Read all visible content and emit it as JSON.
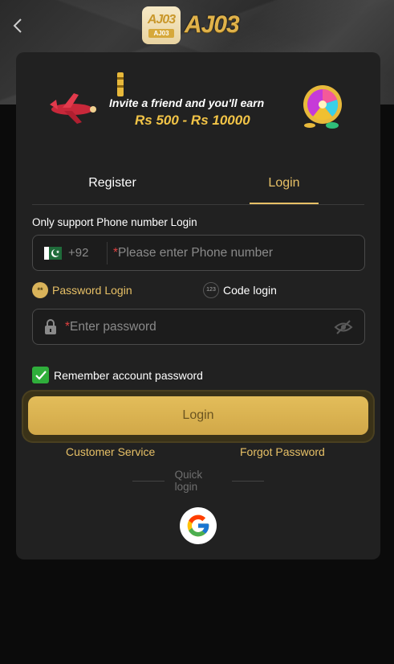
{
  "header": {
    "logo_badge_big": "AJ03",
    "logo_badge_small": "AJ03",
    "logo_text": "AJ03"
  },
  "banner": {
    "line1": "Invite a friend and you'll earn",
    "line2": "Rs 500 - Rs 10000"
  },
  "tabs": [
    {
      "label": "Register",
      "active": false
    },
    {
      "label": "Login",
      "active": true
    }
  ],
  "form": {
    "support_label": "Only support Phone number Login",
    "country_code": "+92",
    "phone_required_mark": "*",
    "phone_placeholder": "Please enter Phone number",
    "mode_password": "Password Login",
    "mode_password_icon": "**",
    "mode_code": "Code login",
    "mode_code_icon": "123",
    "password_required_mark": "*",
    "password_placeholder": "Enter password",
    "remember_label": "Remember account password",
    "remember_checked": true,
    "login_button": "Login"
  },
  "links": {
    "customer_service": "Customer Service",
    "forgot_password": "Forgot Password"
  },
  "quick_login": {
    "label": "Quick login",
    "providers": [
      "google"
    ]
  },
  "colors": {
    "accent": "#e7c066",
    "button": "#d9b050",
    "card": "#212121",
    "checkbox": "#2fae3b"
  }
}
